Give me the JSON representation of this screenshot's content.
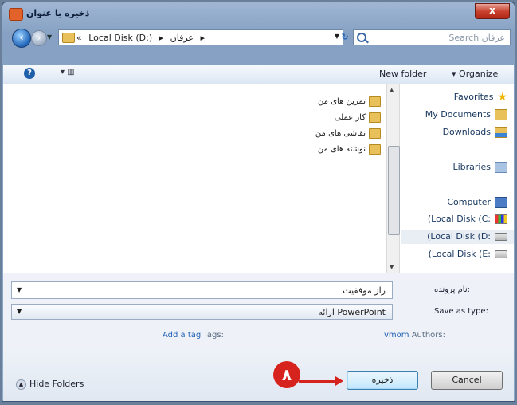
{
  "window": {
    "title": "ذخیره با عنوان",
    "close_label": "x"
  },
  "nav": {
    "breadcrumb": [
      "«",
      "Local Disk (D:)",
      "▸",
      "عرفان",
      "▸"
    ],
    "search_placeholder": "Search عرفان"
  },
  "toolbar": {
    "new_folder": "New folder",
    "organize": "Organize"
  },
  "files": [
    "تمرین های من",
    "کار عملی",
    "نقاشی های من",
    "نوشته های من"
  ],
  "sidebar": {
    "items": [
      {
        "label": "Favorites",
        "icon": "star-icon"
      },
      {
        "label": "My Documents",
        "icon": "folder-icon"
      },
      {
        "label": "Downloads",
        "icon": "downloads-icon"
      },
      {
        "label": "Libraries",
        "icon": "libraries-icon"
      },
      {
        "label": "Computer",
        "icon": "computer-icon"
      },
      {
        "label": "(Local Disk (C:",
        "icon": "windows-disk-icon"
      },
      {
        "label": "(Local Disk (D:",
        "icon": "disk-icon",
        "selected": true
      },
      {
        "label": "(Local Disk (E:",
        "icon": "disk-icon"
      }
    ]
  },
  "form": {
    "filename_label": "نام پرونده:",
    "filename_value": "راز موفقیت",
    "savetype_label": "Save as type:",
    "savetype_value": "ارائه PowerPoint",
    "authors_label": "Authors:",
    "authors_value": "vmom",
    "tags_label": "Tags:",
    "tags_value": "Add a tag"
  },
  "footer": {
    "hide_folders": "Hide Folders",
    "save": "ذخیره",
    "cancel": "Cancel",
    "step_number": "۸"
  }
}
